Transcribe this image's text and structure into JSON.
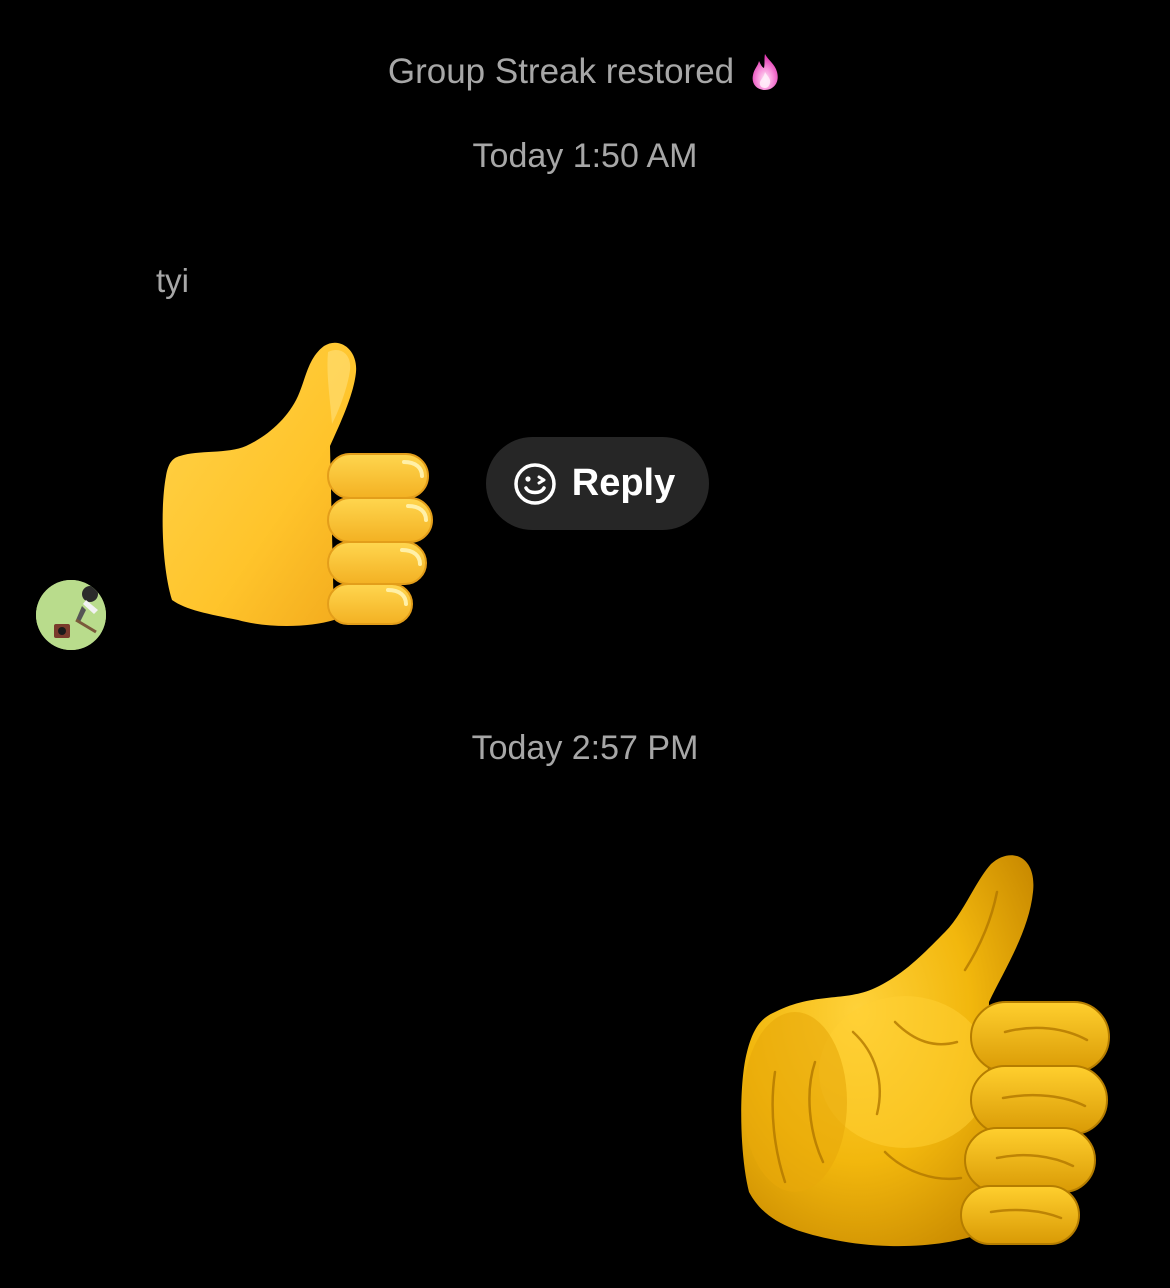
{
  "chat": {
    "system_message": "Group Streak restored",
    "timestamp_1": "Today 1:50 AM",
    "sender_name": "tyi",
    "reply_label": "Reply",
    "timestamp_2": "Today 2:57 PM"
  },
  "icons": {
    "streak": "fire-icon",
    "reply": "smiley-face-icon",
    "message_1": "thumbs-up-emoji",
    "message_2": "thumbs-up-sticker"
  },
  "colors": {
    "background": "#000000",
    "meta_text": "#a7a7a7",
    "reply_pill": "#262626",
    "fire": "#f266c8",
    "emoji_yellow": "#ffc83d"
  }
}
